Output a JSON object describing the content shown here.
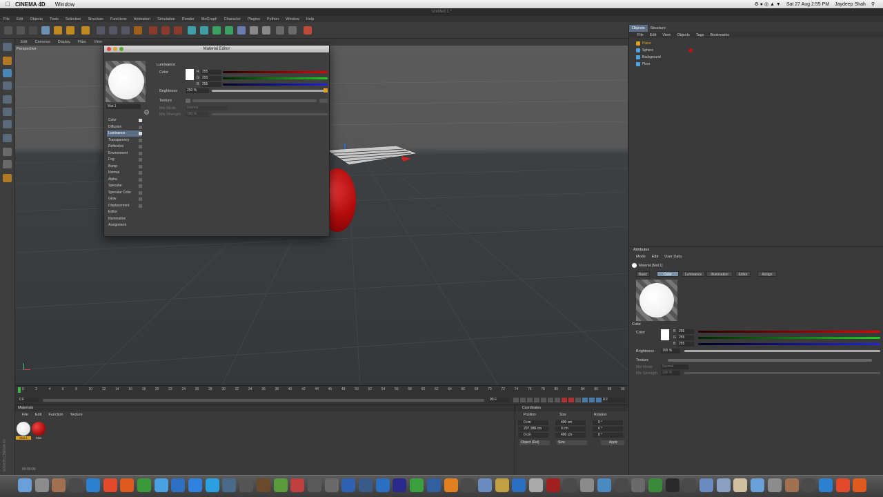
{
  "menubar": {
    "app": "CINEMA 4D",
    "items": [
      "Window"
    ],
    "clock": "Sat 27 Aug  2:55 PM",
    "user": "Jaydeep Shah"
  },
  "window_title": "Untitled 1 *",
  "main_menu": [
    "File",
    "Edit",
    "Objects",
    "Tools",
    "Selection",
    "Structure",
    "Functions",
    "Animation",
    "Simulation",
    "Render",
    "MoGraph",
    "Character",
    "Plugins",
    "Python",
    "Window",
    "Help"
  ],
  "viewport": {
    "menu": [
      "Edit",
      "Cameras",
      "Display",
      "Filter",
      "View"
    ],
    "label": "Perspective"
  },
  "timeline": {
    "ticks": [
      "0",
      "2",
      "4",
      "6",
      "8",
      "10",
      "12",
      "14",
      "16",
      "18",
      "20",
      "22",
      "24",
      "26",
      "28",
      "30",
      "32",
      "34",
      "36",
      "38",
      "40",
      "42",
      "44",
      "46",
      "48",
      "50",
      "52",
      "54",
      "56",
      "58",
      "60",
      "62",
      "64",
      "66",
      "68",
      "70",
      "72",
      "74",
      "76",
      "78",
      "80",
      "82",
      "84",
      "86",
      "88",
      "90"
    ],
    "start": "0 F",
    "end": "90 F",
    "current": "0 F",
    "end_field": "0 F"
  },
  "materials": {
    "title": "Materials",
    "menu": [
      "File",
      "Edit",
      "Function",
      "Texture"
    ],
    "items": [
      {
        "label": "Mat.1",
        "color": "#ffffff"
      },
      {
        "label": "Mat",
        "color": "#cc1111"
      }
    ],
    "time": "00:00:00"
  },
  "coordinates": {
    "title": "Coordinates",
    "headers": [
      "Position",
      "Size",
      "Rotation"
    ],
    "rows": [
      {
        "axis": "X",
        "pos": "0 cm",
        "size": "400 cm",
        "rotlabel": "H",
        "rot": "0 °"
      },
      {
        "axis": "Y",
        "pos": "207.388 cm",
        "size": "0 cm",
        "rotlabel": "P",
        "rot": "0 °"
      },
      {
        "axis": "Z",
        "pos": "0 cm",
        "size": "400 cm",
        "rotlabel": "B",
        "rot": "0 °"
      }
    ],
    "mode": "Object (Rel)",
    "size_mode": "Size",
    "apply": "Apply"
  },
  "objects": {
    "tabs": [
      "Objects",
      "Structure"
    ],
    "menu": [
      "File",
      "Edit",
      "View",
      "Objects",
      "Tags",
      "Bookmarks"
    ],
    "items": [
      {
        "name": "Plane",
        "color": "#e0a020"
      },
      {
        "name": "Sphere",
        "color": "#4fa3e0"
      },
      {
        "name": "Background",
        "color": "#4fa3e0"
      },
      {
        "name": "Floor",
        "color": "#4fa3e0"
      }
    ]
  },
  "attributes": {
    "title": "Attributes",
    "menu": [
      "Mode",
      "Edit",
      "User Data"
    ],
    "object": "Material [Mat.1]",
    "tabs": [
      "Basic",
      "Color",
      "Luminance",
      "Illumination",
      "Editor",
      "Assign"
    ],
    "active_tab": "Color",
    "section": "Color",
    "color_label": "Color",
    "r": "255",
    "g": "255",
    "b": "255",
    "brightness_label": "Brightness",
    "brightness": "100 %",
    "texture_label": "Texture",
    "mix_mode_label": "Mix Mode",
    "mix_mode": "Normal",
    "mix_strength_label": "Mix Strength",
    "mix_strength": "100 %"
  },
  "material_editor": {
    "title": "Material Editor",
    "mat_name": "Mat.1",
    "section": "Luminance",
    "color_label": "Color",
    "r": "255",
    "g": "255",
    "b": "255",
    "brightness_label": "Brightness",
    "brightness": "250 %",
    "texture_label": "Texture",
    "mix_mode_label": "Mix Mode",
    "mix_mode": "Normal",
    "mix_strength_label": "Mix Strength",
    "mix_strength": "100 %",
    "channels": [
      "Color",
      "Diffusion",
      "Luminance",
      "Transparency",
      "Reflection",
      "Environment",
      "Fog",
      "Bump",
      "Normal",
      "Alpha",
      "Specular",
      "Specular Color",
      "Glow",
      "Displacement",
      "Editor",
      "Illumination",
      "Assignment"
    ],
    "selected_channel": "Luminance"
  }
}
